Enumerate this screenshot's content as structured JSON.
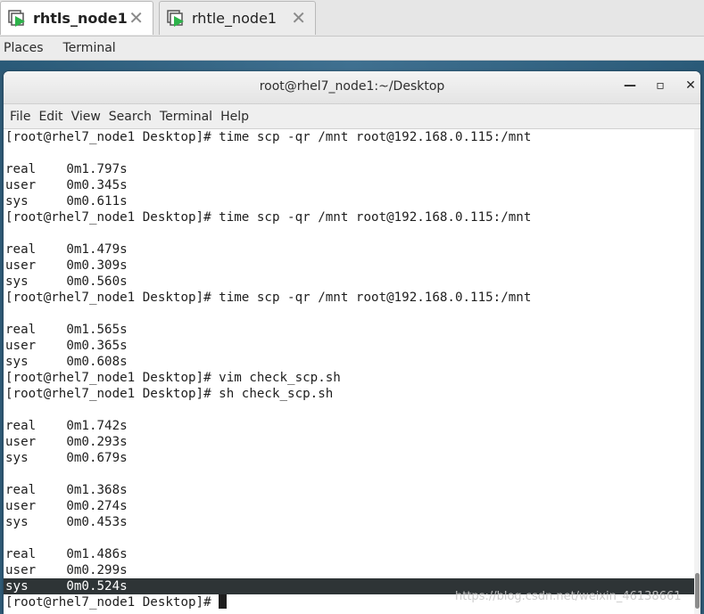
{
  "tabs": [
    {
      "title": "rhtls_node1",
      "close": "✕"
    },
    {
      "title": "rhtle_node1",
      "close": "✕"
    }
  ],
  "panel": {
    "places": "Places",
    "terminal": "Terminal"
  },
  "window": {
    "title": "root@rhel7_node1:~/Desktop",
    "minimize": "—",
    "maximize": "▫",
    "close": "✕"
  },
  "menu": [
    "File",
    "Edit",
    "View",
    "Search",
    "Terminal",
    "Help"
  ],
  "terminal_lines": [
    "[root@rhel7_node1 Desktop]# time scp -qr /mnt root@192.168.0.115:/mnt",
    "",
    "real\t0m1.797s",
    "user\t0m0.345s",
    "sys\t0m0.611s",
    "[root@rhel7_node1 Desktop]# time scp -qr /mnt root@192.168.0.115:/mnt",
    "",
    "real\t0m1.479s",
    "user\t0m0.309s",
    "sys\t0m0.560s",
    "[root@rhel7_node1 Desktop]# time scp -qr /mnt root@192.168.0.115:/mnt",
    "",
    "real\t0m1.565s",
    "user\t0m0.365s",
    "sys\t0m0.608s",
    "[root@rhel7_node1 Desktop]# vim check_scp.sh",
    "[root@rhel7_node1 Desktop]# sh check_scp.sh",
    "",
    "real\t0m1.742s",
    "user\t0m0.293s",
    "sys\t0m0.679s",
    "",
    "real\t0m1.368s",
    "user\t0m0.274s",
    "sys\t0m0.453s",
    "",
    "real\t0m1.486s",
    "user\t0m0.299s",
    "sys\t0m0.524s",
    "[root@rhel7_node1 Desktop]# "
  ],
  "selected_line_index": 28,
  "watermark": "https://blog.csdn.net/weixin_46138661",
  "colors": {
    "accent_icon": "#2db34a",
    "selection_bg": "#2e3436"
  }
}
